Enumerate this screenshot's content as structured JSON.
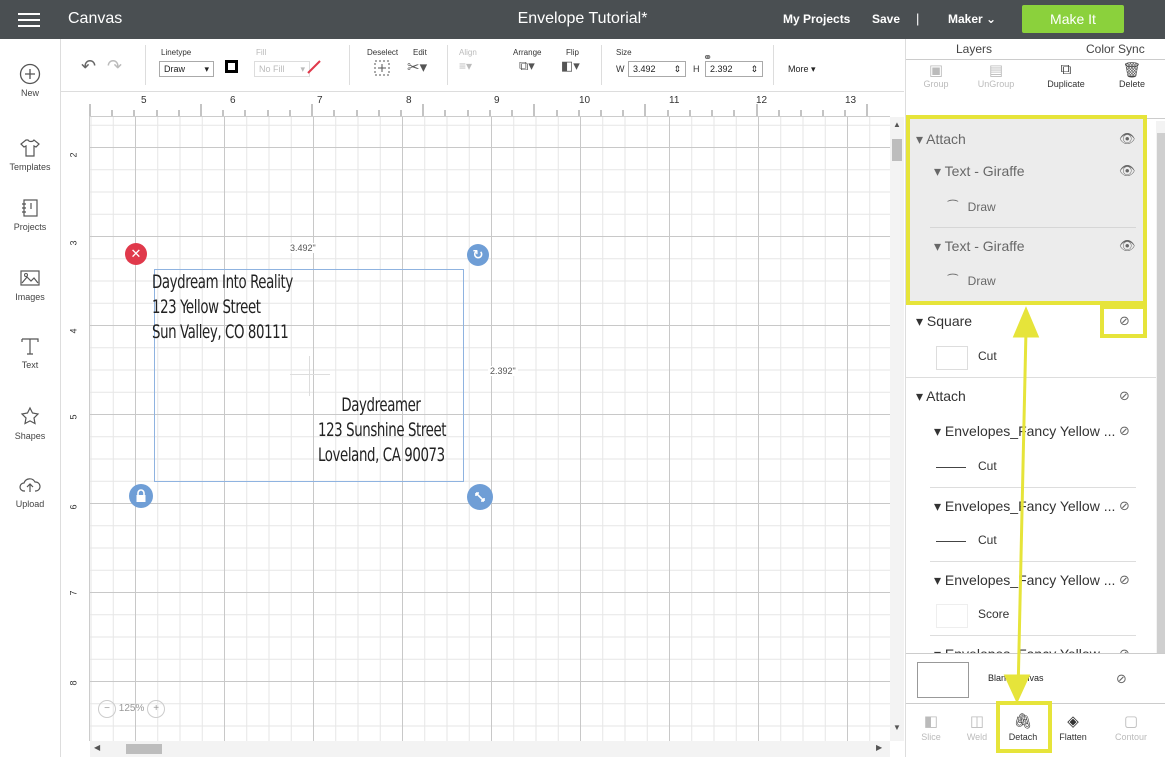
{
  "topbar": {
    "section": "Canvas",
    "document_title": "Envelope Tutorial*",
    "my_projects": "My Projects",
    "save": "Save",
    "separator": "|",
    "machine": "Maker",
    "make_it": "Make It"
  },
  "leftnav": {
    "items": [
      {
        "label": "New",
        "icon": "plus-circle-icon"
      },
      {
        "label": "Templates",
        "icon": "shirt-icon"
      },
      {
        "label": "Projects",
        "icon": "projects-icon"
      },
      {
        "label": "Images",
        "icon": "image-icon"
      },
      {
        "label": "Text",
        "icon": "text-icon"
      },
      {
        "label": "Shapes",
        "icon": "shapes-icon"
      },
      {
        "label": "Upload",
        "icon": "upload-icon"
      }
    ]
  },
  "toolbar": {
    "linetype_label": "Linetype",
    "linetype_value": "Draw",
    "fill_label": "Fill",
    "fill_value": "No Fill",
    "deselect_label": "Deselect",
    "edit_label": "Edit",
    "align_label": "Align",
    "arrange_label": "Arrange",
    "flip_label": "Flip",
    "size_label": "Size",
    "w_label": "W",
    "w_value": "3.492",
    "h_label": "H",
    "h_value": "2.392",
    "more_label": "More",
    "line_color": "#000000"
  },
  "rulers": {
    "top": [
      "5",
      "6",
      "7",
      "8",
      "9",
      "10",
      "11",
      "12",
      "13"
    ],
    "left": [
      "2",
      "3",
      "4",
      "5",
      "6",
      "7",
      "8"
    ]
  },
  "canvas": {
    "return_address": [
      "Daydream Into Reality",
      "123 Yellow Street",
      "Sun Valley, CO 80111"
    ],
    "recipient_address": [
      "Daydreamer",
      "123 Sunshine Street",
      "Loveland, CA 90073"
    ],
    "width_label": "3.492\"",
    "height_label": "2.392\"",
    "zoom": "125%",
    "delete_handle_color": "#e0394b",
    "handle_color": "#6f9ed6"
  },
  "layers_panel": {
    "tabs": [
      "Layers",
      "Color Sync"
    ],
    "tools": [
      "Group",
      "UnGroup",
      "Duplicate",
      "Delete"
    ],
    "layers": [
      {
        "name": "Attach"
      },
      {
        "name": "Text - Giraffe"
      },
      {
        "name": "Draw"
      },
      {
        "name": "Text - Giraffe"
      },
      {
        "name": "Draw"
      },
      {
        "name": "Square"
      },
      {
        "name": "Cut"
      },
      {
        "name": "Attach"
      },
      {
        "name": "Envelopes_Fancy Yellow ..."
      },
      {
        "name": "Cut"
      },
      {
        "name": "Envelopes_Fancy Yellow ..."
      },
      {
        "name": "Cut"
      },
      {
        "name": "Envelopes_Fancy Yellow ..."
      },
      {
        "name": "Score"
      },
      {
        "name": "Envelopes_Fancy Yellow ..."
      }
    ],
    "blank_canvas": "Blank Canvas",
    "bottom_tools": [
      "Slice",
      "Weld",
      "Detach",
      "Flatten",
      "Contour"
    ],
    "highlight_color": "#e6e43a"
  }
}
